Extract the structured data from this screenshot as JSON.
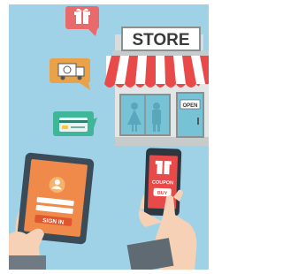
{
  "colors": {
    "background": "#9fd2e6",
    "awning_red": "#e84a4a",
    "awning_white": "#ffffff",
    "tablet_screen": "#f08a4b",
    "phone_screen": "#e84a4a",
    "sign_bg": "#ffffff",
    "sign_text": "#3a3a3a"
  },
  "store": {
    "sign_text": "STORE",
    "door_sign": "OPEN"
  },
  "bubbles": {
    "gift": "gift-icon",
    "delivery": "delivery-truck-icon",
    "card": "credit-card-icon"
  },
  "tablet": {
    "button_label": "SIGN IN"
  },
  "phone": {
    "coupon_label": "COUPON",
    "buy_label": "BUY"
  }
}
